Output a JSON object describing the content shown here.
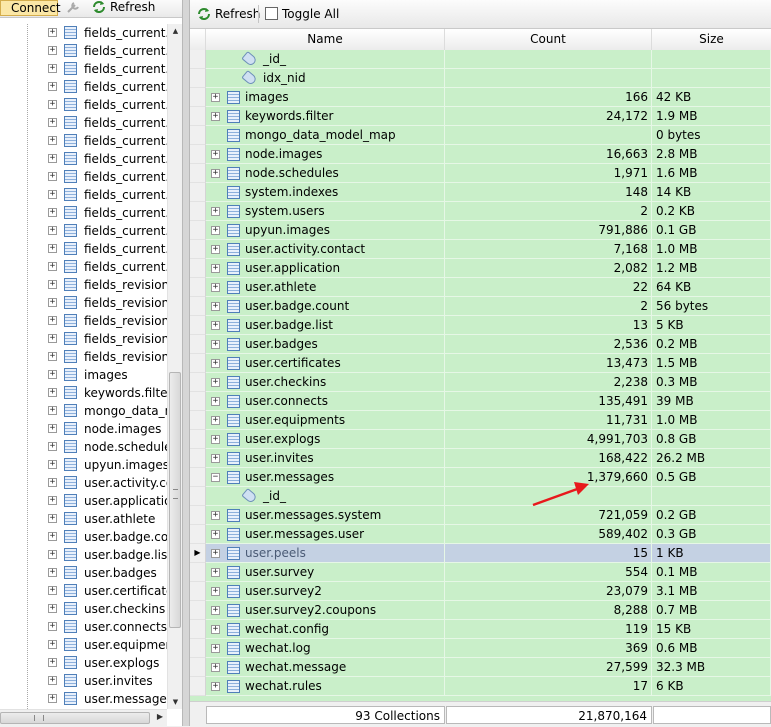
{
  "left_toolbar": {
    "connect_label": "Connect",
    "refresh_label": "Refresh"
  },
  "left_tree": [
    "fields_current.c",
    "fields_current.c",
    "fields_current.c",
    "fields_current.fi",
    "fields_current.n",
    "fields_current.n",
    "fields_current.n",
    "fields_current.s",
    "fields_current.s",
    "fields_current.s",
    "fields_current.s",
    "fields_current.ta",
    "fields_current.ta",
    "fields_current.u",
    "fields_revision.c",
    "fields_revision.c",
    "fields_revision.c",
    "fields_revision.c",
    "fields_revision.n",
    "images",
    "keywords.filter",
    "mongo_data_m",
    "node.images",
    "node.schedules",
    "upyun.images",
    "user.activity.co",
    "user.applicatio",
    "user.athlete",
    "user.badge.cou",
    "user.badge.list",
    "user.badges",
    "user.certificates",
    "user.checkins",
    "user.connects",
    "user.equipmen",
    "user.explogs",
    "user.invites",
    "user.messages"
  ],
  "right_toolbar": {
    "refresh_label": "Refresh",
    "toggle_label": "Toggle All"
  },
  "grid": {
    "columns": {
      "name": "Name",
      "count": "Count",
      "size": "Size"
    },
    "rows": [
      {
        "kind": "index",
        "name": "_id_",
        "count": "",
        "size": ""
      },
      {
        "kind": "index",
        "name": "idx_nid",
        "count": "",
        "size": ""
      },
      {
        "kind": "collection",
        "expand": true,
        "name": "images",
        "count": "166",
        "size": "42 KB"
      },
      {
        "kind": "collection",
        "expand": true,
        "name": "keywords.filter",
        "count": "24,172",
        "size": "1.9 MB"
      },
      {
        "kind": "collection",
        "expand": false,
        "name": "mongo_data_model_map",
        "count": "",
        "size": "0 bytes"
      },
      {
        "kind": "collection",
        "expand": true,
        "name": "node.images",
        "count": "16,663",
        "size": "2.8 MB"
      },
      {
        "kind": "collection",
        "expand": true,
        "name": "node.schedules",
        "count": "1,971",
        "size": "1.6 MB"
      },
      {
        "kind": "collection",
        "expand": false,
        "name": "system.indexes",
        "count": "148",
        "size": "14 KB"
      },
      {
        "kind": "collection",
        "expand": true,
        "name": "system.users",
        "count": "2",
        "size": "0.2 KB"
      },
      {
        "kind": "collection",
        "expand": true,
        "name": "upyun.images",
        "count": "791,886",
        "size": "0.1 GB"
      },
      {
        "kind": "collection",
        "expand": true,
        "name": "user.activity.contact",
        "count": "7,168",
        "size": "1.0 MB"
      },
      {
        "kind": "collection",
        "expand": true,
        "name": "user.application",
        "count": "2,082",
        "size": "1.2 MB"
      },
      {
        "kind": "collection",
        "expand": true,
        "name": "user.athlete",
        "count": "22",
        "size": "64 KB"
      },
      {
        "kind": "collection",
        "expand": true,
        "name": "user.badge.count",
        "count": "2",
        "size": "56 bytes"
      },
      {
        "kind": "collection",
        "expand": true,
        "name": "user.badge.list",
        "count": "13",
        "size": "5 KB"
      },
      {
        "kind": "collection",
        "expand": true,
        "name": "user.badges",
        "count": "2,536",
        "size": "0.2 MB"
      },
      {
        "kind": "collection",
        "expand": true,
        "name": "user.certificates",
        "count": "13,473",
        "size": "1.5 MB"
      },
      {
        "kind": "collection",
        "expand": true,
        "name": "user.checkins",
        "count": "2,238",
        "size": "0.3 MB"
      },
      {
        "kind": "collection",
        "expand": true,
        "name": "user.connects",
        "count": "135,491",
        "size": "39 MB"
      },
      {
        "kind": "collection",
        "expand": true,
        "name": "user.equipments",
        "count": "11,731",
        "size": "1.0 MB"
      },
      {
        "kind": "collection",
        "expand": true,
        "name": "user.explogs",
        "count": "4,991,703",
        "size": "0.8 GB"
      },
      {
        "kind": "collection",
        "expand": true,
        "name": "user.invites",
        "count": "168,422",
        "size": "26.2 MB"
      },
      {
        "kind": "collection",
        "expand": true,
        "expanded": true,
        "name": "user.messages",
        "count": "1,379,660",
        "size": "0.5 GB"
      },
      {
        "kind": "index",
        "name": "_id_",
        "count": "",
        "size": ""
      },
      {
        "kind": "collection",
        "expand": true,
        "name": "user.messages.system",
        "count": "721,059",
        "size": "0.2 GB"
      },
      {
        "kind": "collection",
        "expand": true,
        "name": "user.messages.user",
        "count": "589,402",
        "size": "0.3 GB"
      },
      {
        "kind": "collection",
        "expand": true,
        "selected": true,
        "name": "user.peels",
        "count": "15",
        "size": "1 KB"
      },
      {
        "kind": "collection",
        "expand": true,
        "name": "user.survey",
        "count": "554",
        "size": "0.1 MB"
      },
      {
        "kind": "collection",
        "expand": true,
        "name": "user.survey2",
        "count": "23,079",
        "size": "3.1 MB"
      },
      {
        "kind": "collection",
        "expand": true,
        "name": "user.survey2.coupons",
        "count": "8,288",
        "size": "0.7 MB"
      },
      {
        "kind": "collection",
        "expand": true,
        "name": "wechat.config",
        "count": "119",
        "size": "15 KB"
      },
      {
        "kind": "collection",
        "expand": true,
        "name": "wechat.log",
        "count": "369",
        "size": "0.6 MB"
      },
      {
        "kind": "collection",
        "expand": true,
        "name": "wechat.message",
        "count": "27,599",
        "size": "32.3 MB"
      },
      {
        "kind": "collection",
        "expand": true,
        "name": "wechat.rules",
        "count": "17",
        "size": "6 KB"
      }
    ]
  },
  "footer": {
    "collections": "93 Collections",
    "total_count": "21,870,164",
    "total_size": ""
  },
  "colors": {
    "row_bg": "#c9efc9",
    "selected_bg": "#c4d1e3",
    "annotation_arrow": "#e8191c"
  }
}
